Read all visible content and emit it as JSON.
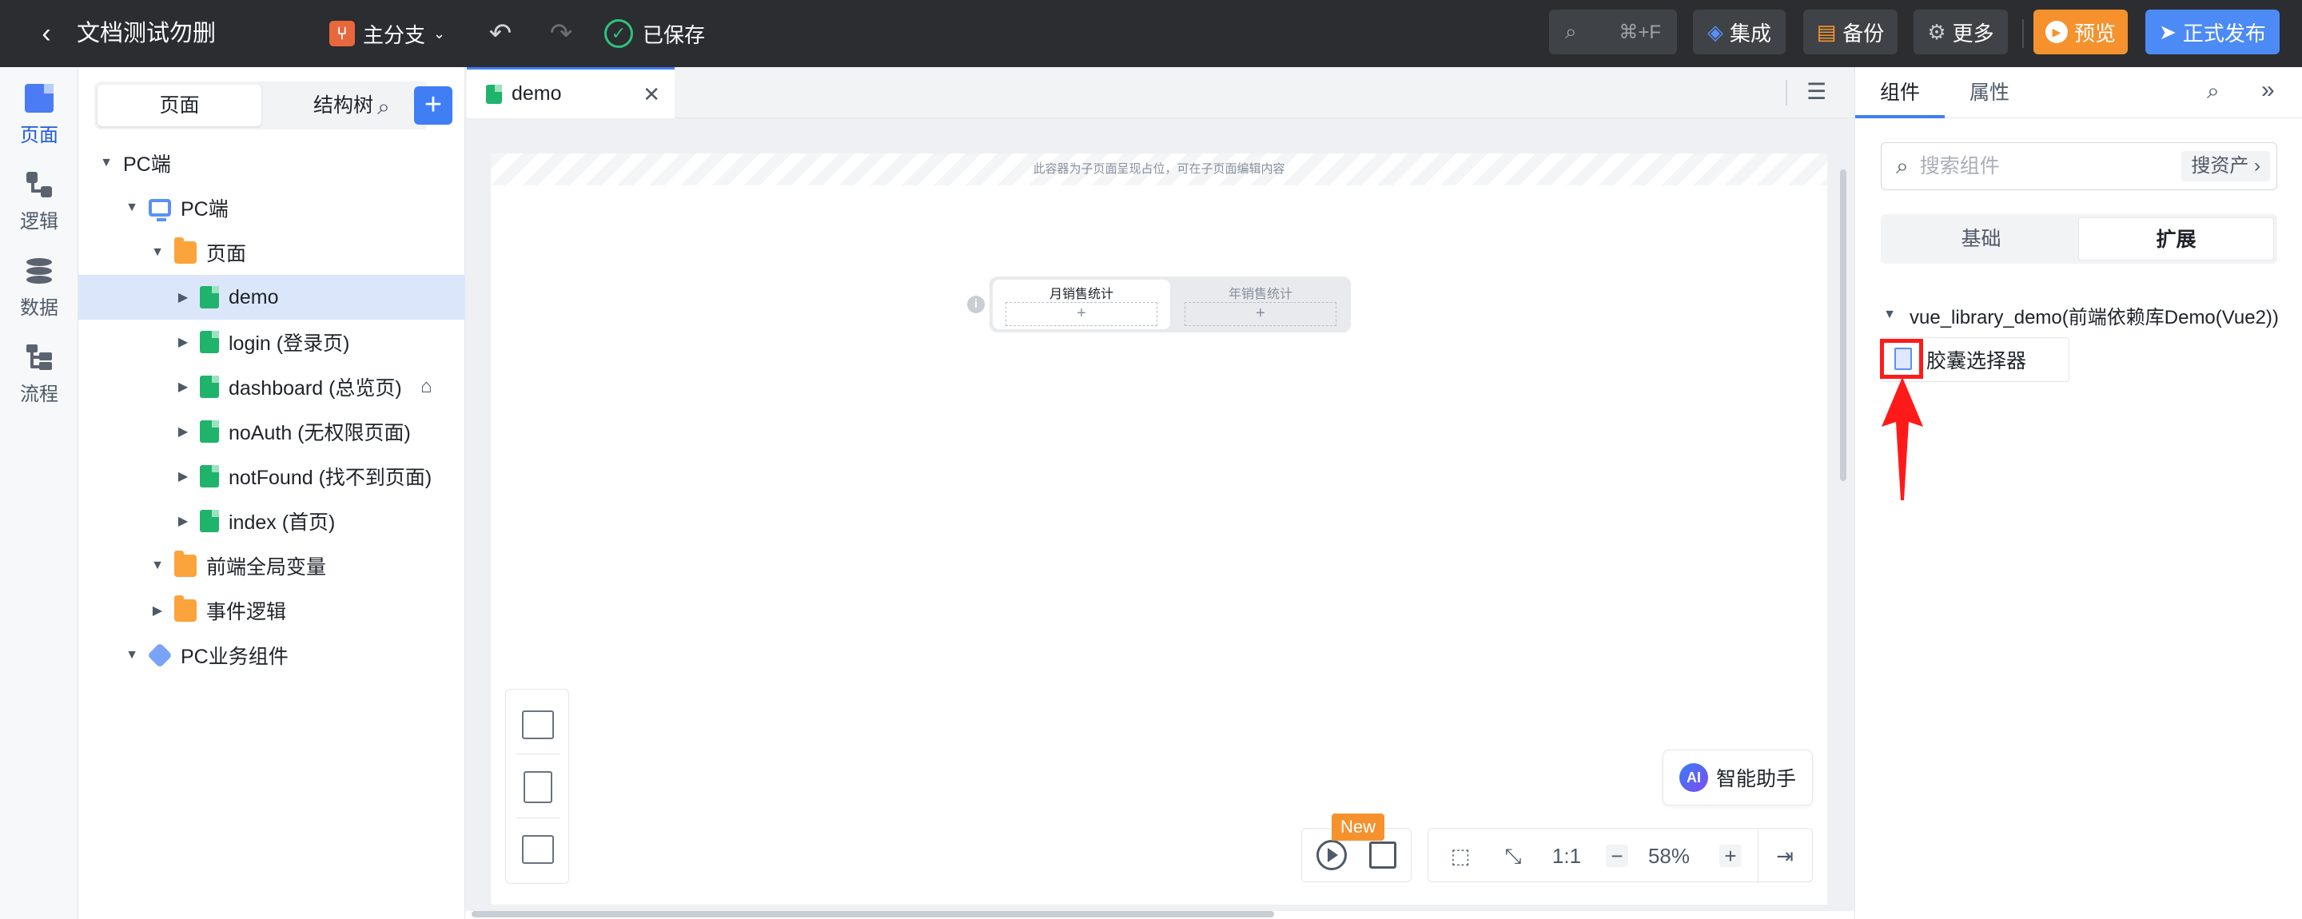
{
  "topbar": {
    "title": "文档测试勿删",
    "branch": "主分支",
    "saved": "已保存",
    "search_shortcut": "⌘+F",
    "integrate": "集成",
    "backup": "备份",
    "more": "更多",
    "preview": "预览",
    "publish": "正式发布"
  },
  "rail": [
    {
      "label": "页面",
      "active": true
    },
    {
      "label": "逻辑"
    },
    {
      "label": "数据"
    },
    {
      "label": "流程"
    }
  ],
  "tree_panel": {
    "tabs": [
      "页面",
      "结构树"
    ],
    "active_tab": "页面",
    "rows": [
      {
        "label": "PC端",
        "icon": "none",
        "expanded": true
      },
      {
        "label": "PC端",
        "icon": "monitor-icon",
        "expanded": true
      },
      {
        "label": "页面",
        "icon": "folder-icon",
        "expanded": true
      },
      {
        "label": "demo",
        "icon": "page-file-icon",
        "selected": true
      },
      {
        "label": "login (登录页)",
        "icon": "page-file-icon"
      },
      {
        "label": "dashboard (总览页)",
        "icon": "page-file-icon",
        "home": true
      },
      {
        "label": "noAuth (无权限页面)",
        "icon": "page-file-icon"
      },
      {
        "label": "notFound (找不到页面)",
        "icon": "page-file-icon"
      },
      {
        "label": "index (首页)",
        "icon": "page-file-icon"
      },
      {
        "label": "前端全局变量",
        "icon": "folder-icon",
        "expanded": true
      },
      {
        "label": "事件逻辑",
        "icon": "folder-icon"
      },
      {
        "label": "PC业务组件",
        "icon": "puzzle-icon",
        "expanded": true
      }
    ]
  },
  "editor": {
    "tab": "demo",
    "placeholder_banner": "此容器为子页面呈现占位，可在子页面编辑内容",
    "tabs_component": [
      "月销售统计",
      "年销售统计"
    ],
    "slot_plus": "+",
    "ai_assistant": "智能助手",
    "ai_badge": "AI",
    "new_badge": "New",
    "ratio": "1:1",
    "zoom": "58%"
  },
  "right_panel": {
    "tabs": [
      "组件",
      "属性"
    ],
    "active_tab": "组件",
    "search_placeholder": "搜索组件",
    "asset_button": "搜资产",
    "segments": [
      "基础",
      "扩展"
    ],
    "active_segment": "扩展",
    "library": "vue_library_demo(前端依赖库Demo(Vue2))",
    "component": "胶囊选择器"
  },
  "colors": {
    "accent": "#3f7ef5",
    "topbar": "#2b2d30",
    "preview": "#f5922e",
    "highlight": "#ff1a1a"
  }
}
